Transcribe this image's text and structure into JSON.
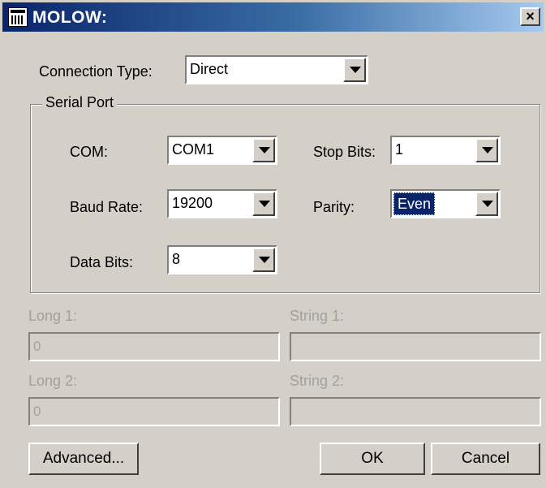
{
  "window": {
    "title": "MOLOW:",
    "close_label": "×"
  },
  "connection": {
    "label": "Connection Type:",
    "value": "Direct"
  },
  "serial_port": {
    "legend": "Serial Port",
    "com": {
      "label": "COM:",
      "value": "COM1"
    },
    "baud_rate": {
      "label": "Baud Rate:",
      "value": "19200"
    },
    "data_bits": {
      "label": "Data Bits:",
      "value": "8"
    },
    "stop_bits": {
      "label": "Stop Bits:",
      "value": "1"
    },
    "parity": {
      "label": "Parity:",
      "value": "Even"
    }
  },
  "fields": {
    "long1": {
      "label": "Long 1:",
      "value": "0"
    },
    "string1": {
      "label": "String 1:",
      "value": ""
    },
    "long2": {
      "label": "Long 2:",
      "value": "0"
    },
    "string2": {
      "label": "String 2:",
      "value": ""
    }
  },
  "buttons": {
    "advanced": "Advanced...",
    "ok": "OK",
    "cancel": "Cancel"
  },
  "colors": {
    "titlebar_start": "#0a246a",
    "titlebar_end": "#a6caf0",
    "face": "#d4d0c8",
    "selection": "#0a246a",
    "disabled_text": "#a0a0a0"
  },
  "icons": {
    "app": "app-window-icon",
    "close": "close-icon",
    "dropdown": "chevron-down-icon"
  }
}
